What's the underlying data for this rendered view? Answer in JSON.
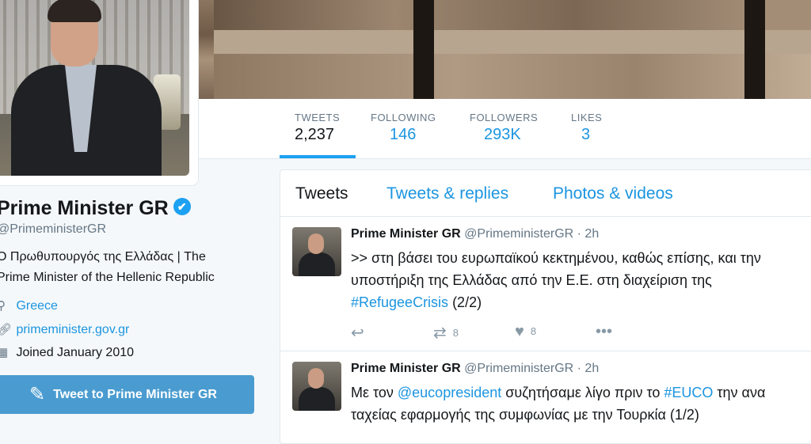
{
  "profile": {
    "name": "Prime Minister GR",
    "verified_icon": "✔",
    "handle": "@PrimeministerGR",
    "bio_line1": "Ο Πρωθυπουργός της Ελλάδας | The",
    "bio_line2": "Prime Minister of the Hellenic Republic",
    "location": "Greece",
    "website": "primeminister.gov.gr",
    "joined": "Joined January 2010",
    "tweet_button": "Tweet to Prime Minister GR"
  },
  "stats": [
    {
      "label": "TWEETS",
      "value": "2,237"
    },
    {
      "label": "FOLLOWING",
      "value": "146"
    },
    {
      "label": "FOLLOWERS",
      "value": "293K"
    },
    {
      "label": "LIKES",
      "value": "3"
    }
  ],
  "tabs": [
    {
      "label": "Tweets"
    },
    {
      "label": "Tweets & replies"
    },
    {
      "label": "Photos & videos"
    }
  ],
  "tweets": [
    {
      "name": "Prime Minister GR",
      "handle": "@PrimeministerGR",
      "sep": "·",
      "time": "2h",
      "line1": ">> στη βάσει του ευρωπαϊκού κεκτημένου, καθώς επίσης, και την",
      "line2": "υποστήριξη της Ελλάδας από την Ε.Ε. στη διαχείριση της",
      "hashtag": "#RefugeeCrisis",
      "line3_rest": " (2/2)",
      "retweets": "8",
      "likes": "8"
    },
    {
      "name": "Prime Minister GR",
      "handle": "@PrimeministerGR",
      "sep": "·",
      "time": "2h",
      "pre1": "Με τον ",
      "mention": "@eucopresident",
      "mid1": " συζητήσαμε λίγο πριν το ",
      "hashtag": "#EUCO",
      "post1": " την ανα",
      "line2": "ταχείας εφαρμογής της συμφωνίας με την Τουρκία (1/2)"
    }
  ],
  "icons": {
    "location": "location-pin-icon",
    "link": "link-icon",
    "calendar": "calendar-icon",
    "reply": "reply-icon",
    "retweet": "retweet-icon",
    "like": "heart-icon",
    "more": "more-icon",
    "quill": "quill-icon"
  },
  "colors": {
    "accent": "#1da1f2",
    "link": "#1b95e0",
    "button": "#4a9cd0"
  }
}
